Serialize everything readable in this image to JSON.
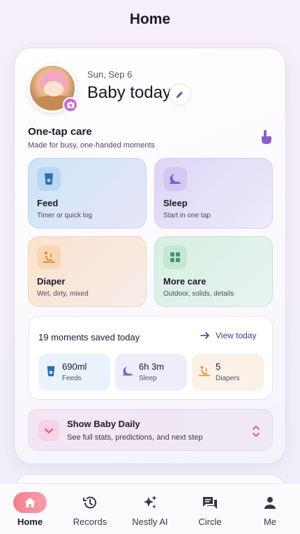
{
  "header": {
    "title": "Home"
  },
  "profile": {
    "date": "Sun, Sep 6",
    "headline": "Baby today"
  },
  "care": {
    "title": "One-tap care",
    "subtitle": "Made for busy, one-handed moments",
    "tiles": [
      {
        "label": "Feed",
        "sub": "Timer or quick log",
        "icon": "bottle-icon"
      },
      {
        "label": "Sleep",
        "sub": "Start in one tap",
        "icon": "moon-icon"
      },
      {
        "label": "Diaper",
        "sub": "Wet, dirty, mixed",
        "icon": "baby-changing-icon"
      },
      {
        "label": "More care",
        "sub": "Outdoor, solids, details",
        "icon": "grid-icon"
      }
    ]
  },
  "moments": {
    "title": "19 moments saved today",
    "view_label": "View today",
    "stats": [
      {
        "value": "690ml",
        "label": "Feeds"
      },
      {
        "value": "6h 3m",
        "label": "Sleep"
      },
      {
        "value": "5",
        "label": "Diapers"
      }
    ]
  },
  "daily": {
    "title": "Show Baby Daily",
    "subtitle": "See full stats, predictions, and next step"
  },
  "nav": {
    "items": [
      {
        "label": "Home",
        "icon": "home-icon",
        "active": true
      },
      {
        "label": "Records",
        "icon": "history-icon"
      },
      {
        "label": "Nestly AI",
        "icon": "sparkles-icon"
      },
      {
        "label": "Circle",
        "icon": "chat-icon"
      },
      {
        "label": "Me",
        "icon": "person-icon"
      }
    ]
  },
  "colors": {
    "accent": "#c76ad7",
    "feed": "#2a6fb0",
    "sleep": "#7b5fc9",
    "diaper": "#e39230",
    "more": "#3e9a6a",
    "home_active": "#f47e90"
  }
}
